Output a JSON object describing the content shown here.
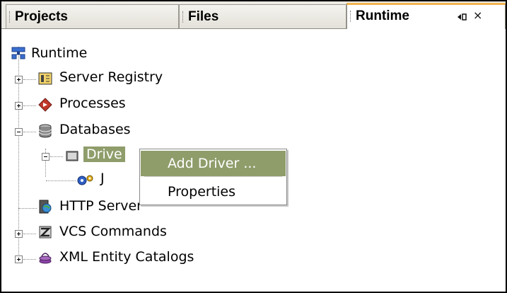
{
  "tabs": [
    {
      "label": "Projects",
      "active": false
    },
    {
      "label": "Files",
      "active": false
    },
    {
      "label": "Runtime",
      "active": true
    }
  ],
  "tab_controls": {
    "minimize_glyph": "◂▯",
    "close_glyph": "×"
  },
  "tree": {
    "root": {
      "label": "Runtime",
      "icon": "runtime-network-icon"
    },
    "items": [
      {
        "label": "Server Registry",
        "icon": "server-registry-icon",
        "expander": "plus"
      },
      {
        "label": "Processes",
        "icon": "processes-icon",
        "expander": "plus"
      },
      {
        "label": "Databases",
        "icon": "database-icon",
        "expander": "minus"
      },
      {
        "label": "Drive",
        "icon": "folder-icon",
        "expander": "minus",
        "selected": true
      },
      {
        "label": "J",
        "icon": "driver-gears-icon"
      },
      {
        "label": "HTTP Server",
        "icon": "http-server-icon"
      },
      {
        "label": "VCS Commands",
        "icon": "vcs-commands-icon",
        "expander": "plus"
      },
      {
        "label": "XML Entity Catalogs",
        "icon": "xml-catalog-icon",
        "expander": "plus"
      }
    ]
  },
  "context_menu": {
    "items": [
      {
        "label": "Add Driver ...",
        "highlighted": true
      },
      {
        "label": "Properties",
        "highlighted": false
      }
    ]
  },
  "colors": {
    "selection": "#8f9d6b",
    "active_tab_accent": "#f0b450",
    "tab_background": "#eceae4"
  }
}
